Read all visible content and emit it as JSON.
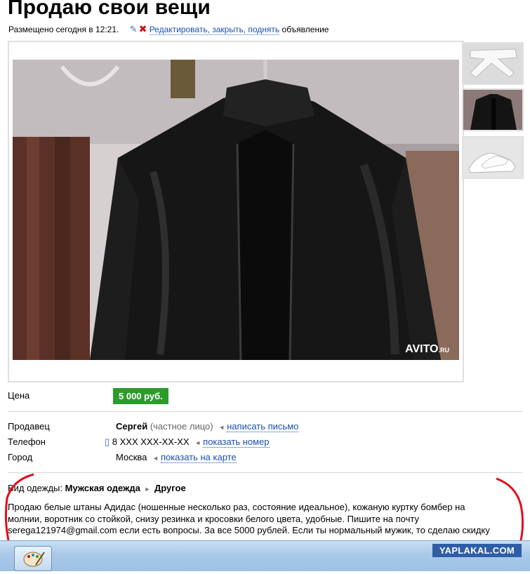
{
  "header": {
    "title": "Продаю свои вещи",
    "posted": "Размещено сегодня в 12:21.",
    "edit_link": "Редактировать, закрыть, поднять",
    "edit_suffix": "объявление",
    "icons": [
      "pencil-icon",
      "delete-x-icon"
    ]
  },
  "photo": {
    "watermark": "AVITO",
    "watermark_suffix": ".RU"
  },
  "thumbnails": [
    "white-trousers",
    "black-leather-jacket",
    "white-sneakers"
  ],
  "price": {
    "label": "Цена",
    "value": "5 000 руб."
  },
  "seller": {
    "label": "Продавец",
    "name": "Сергей",
    "type": "(частное лицо)",
    "action": "написать письмо"
  },
  "phone": {
    "label": "Телефон",
    "number": "8 XXX XXX-XX-XX",
    "action": "показать номер"
  },
  "city": {
    "label": "Город",
    "name": "Москва",
    "action": "показать на карте"
  },
  "category": {
    "label": "Вид одежды:",
    "main": "Мужская одежда",
    "sub": "Другое"
  },
  "description": {
    "line1": "Продаю белые штаны Адидас (ношенные несколько раз, состояние идеальное), кожаную куртку бомбер на",
    "line2": "молнии, воротник со стойкой, снизу резинка и кросовки белого цвета, удобные. Пишите на почту",
    "line3": "serega121974@gmail.com если есть вопросы. За все 5000 рублей. Если ты нормальный мужик, то сделаю скидку"
  },
  "watermark_site": "YAPLAKAL.COM",
  "colors": {
    "price_badge": "#2c9b2c",
    "link": "#1b4fb0",
    "red_annotation": "#e0101a"
  }
}
